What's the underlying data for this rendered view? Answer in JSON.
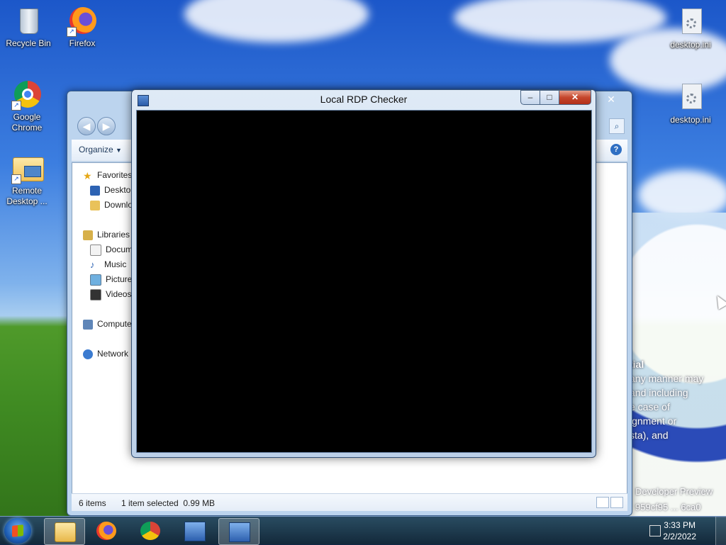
{
  "desktop": {
    "icons": [
      {
        "label": "Recycle Bin"
      },
      {
        "label": "Firefox"
      },
      {
        "label": "Google Chrome"
      },
      {
        "label": "Remote Desktop ..."
      },
      {
        "label": "desktop.ini"
      },
      {
        "label": "desktop.ini"
      }
    ],
    "wallpaper_text": [
      "tial",
      "any manner may",
      "and including",
      "e case of",
      "ignment or",
      "sta), and",
      "Developer Preview",
      "959cf95 ... 6ca0"
    ]
  },
  "explorer": {
    "toolbar": {
      "organize_label": "Organize"
    },
    "tree": [
      {
        "label": "Favorites"
      },
      {
        "label": "Desktop"
      },
      {
        "label": "Downloads"
      },
      {
        "label": "Libraries"
      },
      {
        "label": "Documents"
      },
      {
        "label": "Music"
      },
      {
        "label": "Pictures"
      },
      {
        "label": "Videos"
      },
      {
        "label": "Computer"
      },
      {
        "label": "Network"
      }
    ],
    "status": {
      "items_count": "6 items",
      "selection": "1 item selected  0.99 MB"
    },
    "close_glyph": "✕"
  },
  "rdp_window": {
    "title": "Local RDP Checker",
    "min_glyph": "–",
    "max_glyph": "□",
    "close_glyph": "✕"
  },
  "taskbar": {
    "buttons": [
      {
        "name": "Windows Explorer",
        "icon": "folder-icon"
      },
      {
        "name": "Firefox",
        "icon": "firefox-icon"
      },
      {
        "name": "Google Chrome",
        "icon": "chrome-icon"
      },
      {
        "name": "Remote Desktop Connection",
        "icon": "remote-desktop-icon"
      },
      {
        "name": "Local RDP Checker",
        "icon": "rdp-checker-icon"
      }
    ],
    "clock": {
      "time": "3:33 PM",
      "date": "2/2/2022"
    }
  }
}
